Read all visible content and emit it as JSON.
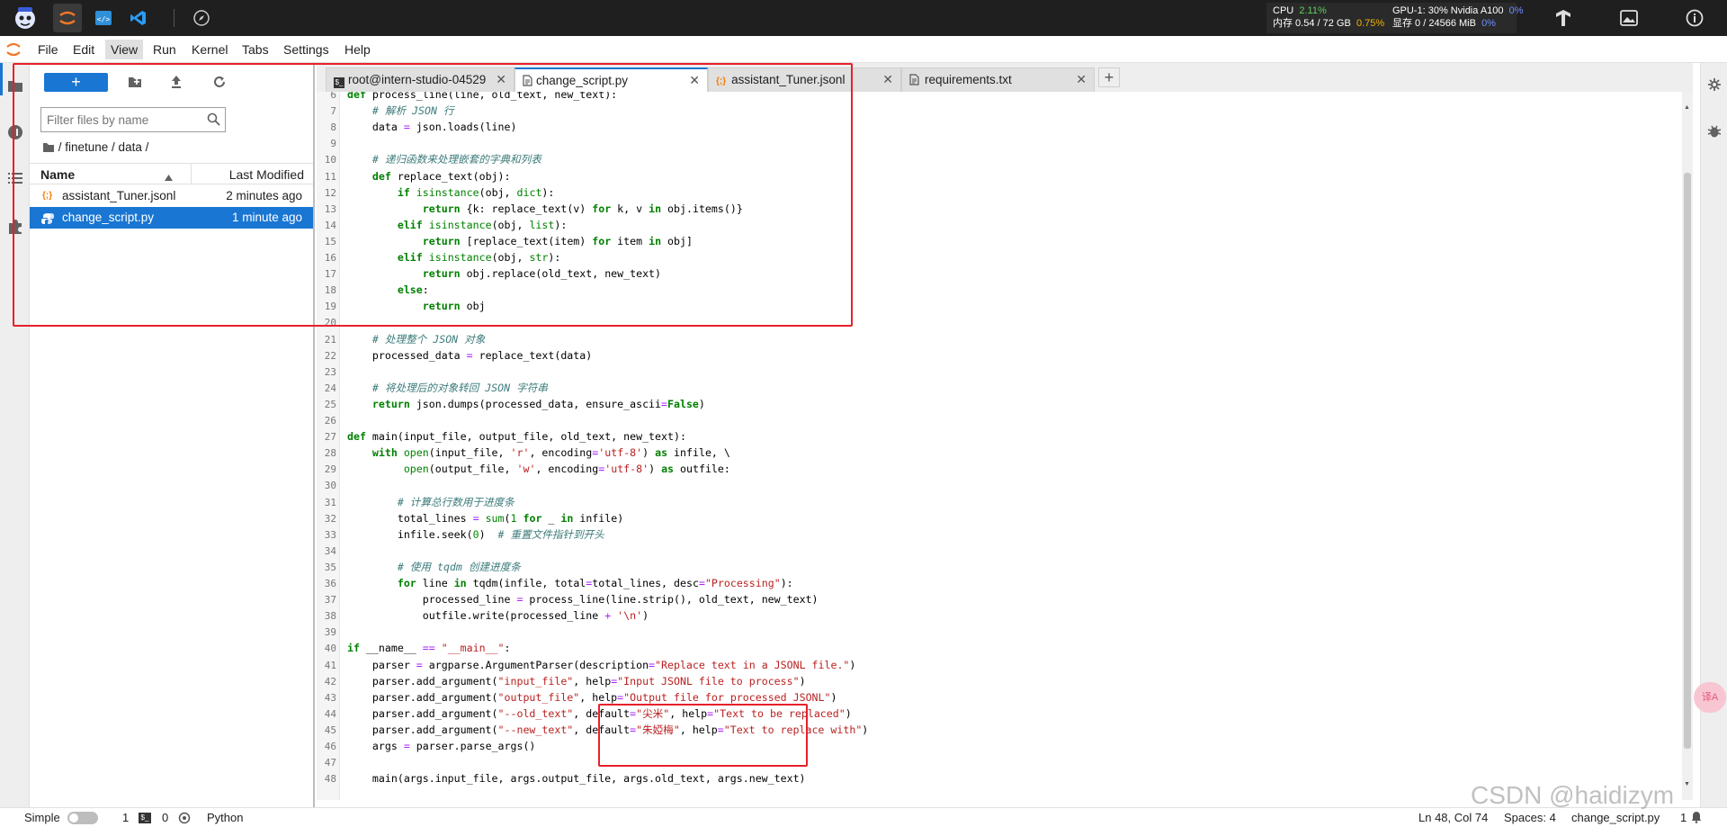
{
  "topbar": {
    "icons": [
      "intern-logo-icon",
      "jupyter-icon",
      "code-editor-icon",
      "vscode-icon",
      "compass-icon"
    ],
    "cpu_label": "CPU",
    "cpu_value": "2.11%",
    "mem_label": "内存 0.54 / 72 GB",
    "mem_value": "0.75%",
    "gpu_label": "GPU-1: 30% Nvidia A100",
    "gpu_value": "0%",
    "vram_label": "显存 0 / 24566 MiB",
    "vram_value": "0%"
  },
  "menubar": {
    "items": [
      "File",
      "Edit",
      "View",
      "Run",
      "Kernel",
      "Tabs",
      "Settings",
      "Help"
    ]
  },
  "filebrowser": {
    "filter_placeholder": "Filter files by name",
    "breadcrumb": "/ finetune / data /",
    "col_name": "Name",
    "col_modified": "Last Modified",
    "files": [
      {
        "name": "assistant_Tuner.jsonl",
        "modified": "2 minutes ago",
        "type": "json"
      },
      {
        "name": "change_script.py",
        "modified": "1 minute ago",
        "type": "python"
      }
    ]
  },
  "tabs": [
    {
      "label": "root@intern-studio-04529",
      "icon": "terminal-icon"
    },
    {
      "label": "change_script.py",
      "icon": "file-icon"
    },
    {
      "label": "assistant_Tuner.jsonl",
      "icon": "json-icon"
    },
    {
      "label": "requirements.txt",
      "icon": "file-icon"
    }
  ],
  "editor": {
    "lines": [
      {
        "n": "6",
        "code": "def process_line(line, old_text, new_text):"
      },
      {
        "n": "7",
        "code": "    # 解析 JSON 行"
      },
      {
        "n": "8",
        "code": "    data = json.loads(line)"
      },
      {
        "n": "9",
        "code": ""
      },
      {
        "n": "10",
        "code": "    # 递归函数来处理嵌套的字典和列表"
      },
      {
        "n": "11",
        "code": "    def replace_text(obj):"
      },
      {
        "n": "12",
        "code": "        if isinstance(obj, dict):"
      },
      {
        "n": "13",
        "code": "            return {k: replace_text(v) for k, v in obj.items()}"
      },
      {
        "n": "14",
        "code": "        elif isinstance(obj, list):"
      },
      {
        "n": "15",
        "code": "            return [replace_text(item) for item in obj]"
      },
      {
        "n": "16",
        "code": "        elif isinstance(obj, str):"
      },
      {
        "n": "17",
        "code": "            return obj.replace(old_text, new_text)"
      },
      {
        "n": "18",
        "code": "        else:"
      },
      {
        "n": "19",
        "code": "            return obj"
      },
      {
        "n": "20",
        "code": ""
      },
      {
        "n": "21",
        "code": "    # 处理整个 JSON 对象"
      },
      {
        "n": "22",
        "code": "    processed_data = replace_text(data)"
      },
      {
        "n": "23",
        "code": ""
      },
      {
        "n": "24",
        "code": "    # 将处理后的对象转回 JSON 字符串"
      },
      {
        "n": "25",
        "code": "    return json.dumps(processed_data, ensure_ascii=False)"
      },
      {
        "n": "26",
        "code": ""
      },
      {
        "n": "27",
        "code": "def main(input_file, output_file, old_text, new_text):"
      },
      {
        "n": "28",
        "code": "    with open(input_file, 'r', encoding='utf-8') as infile, \\"
      },
      {
        "n": "29",
        "code": "         open(output_file, 'w', encoding='utf-8') as outfile:"
      },
      {
        "n": "30",
        "code": ""
      },
      {
        "n": "31",
        "code": "        # 计算总行数用于进度条"
      },
      {
        "n": "32",
        "code": "        total_lines = sum(1 for _ in infile)"
      },
      {
        "n": "33",
        "code": "        infile.seek(0)  # 重置文件指针到开头"
      },
      {
        "n": "34",
        "code": ""
      },
      {
        "n": "35",
        "code": "        # 使用 tqdm 创建进度条"
      },
      {
        "n": "36",
        "code": "        for line in tqdm(infile, total=total_lines, desc=\"Processing\"):"
      },
      {
        "n": "37",
        "code": "            processed_line = process_line(line.strip(), old_text, new_text)"
      },
      {
        "n": "38",
        "code": "            outfile.write(processed_line + '\\n')"
      },
      {
        "n": "39",
        "code": ""
      },
      {
        "n": "40",
        "code": "if __name__ == \"__main__\":"
      },
      {
        "n": "41",
        "code": "    parser = argparse.ArgumentParser(description=\"Replace text in a JSONL file.\")"
      },
      {
        "n": "42",
        "code": "    parser.add_argument(\"input_file\", help=\"Input JSONL file to process\")"
      },
      {
        "n": "43",
        "code": "    parser.add_argument(\"output_file\", help=\"Output file for processed JSONL\")"
      },
      {
        "n": "44",
        "code": "    parser.add_argument(\"--old_text\", default=\"尖米\", help=\"Text to be replaced\")"
      },
      {
        "n": "45",
        "code": "    parser.add_argument(\"--new_text\", default=\"朱婭梅\", help=\"Text to replace with\")"
      },
      {
        "n": "46",
        "code": "    args = parser.parse_args()"
      },
      {
        "n": "47",
        "code": ""
      },
      {
        "n": "48",
        "code": "    main(args.input_file, args.output_file, args.old_text, args.new_text)"
      }
    ]
  },
  "statusbar": {
    "mode": "Simple",
    "terminals": "1",
    "kernels": "0",
    "kernel_name": "Python",
    "cursor": "Ln 48, Col 74",
    "spaces": "Spaces: 4",
    "filename": "change_script.py",
    "notifications": "1"
  },
  "watermark": "CSDN @haidizym",
  "colors": {
    "accent": "#1976d2",
    "annotation": "#e8202a",
    "keyword": "#008000",
    "string": "#ba2121",
    "comment": "#3d7b7b"
  }
}
